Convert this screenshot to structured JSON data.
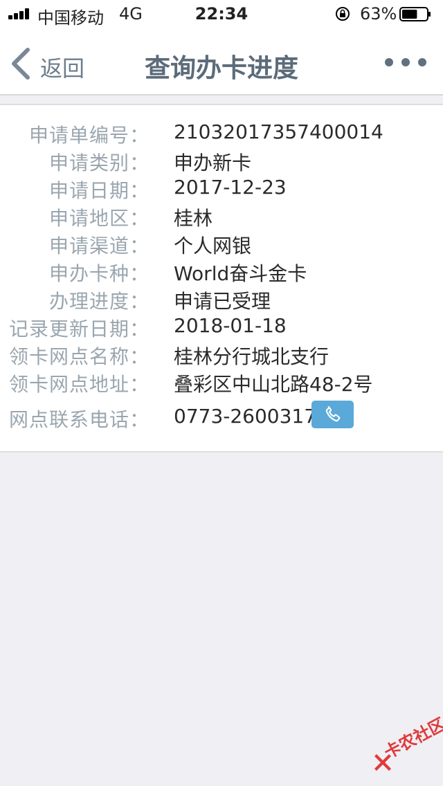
{
  "status_bar": {
    "carrier": "中国移动",
    "network": "4G",
    "time": "22:34",
    "battery_percent": "63%",
    "battery_level": 0.63
  },
  "nav": {
    "back_label": "返回",
    "title": "查询办卡进度"
  },
  "details": [
    {
      "label": "申请单编号：",
      "value": "21032017357400014"
    },
    {
      "label": "申请类别：",
      "value": "申办新卡"
    },
    {
      "label": "申请日期：",
      "value": "2017-12-23"
    },
    {
      "label": "申请地区：",
      "value": "桂林"
    },
    {
      "label": "申请渠道：",
      "value": "个人网银"
    },
    {
      "label": "申办卡种：",
      "value": "World奋斗金卡"
    },
    {
      "label": "办理进度：",
      "value": "申请已受理"
    },
    {
      "label": "记录更新日期：",
      "value": "2018-01-18"
    },
    {
      "label": "领卡网点名称：",
      "value": "桂林分行城北支行"
    },
    {
      "label": "领卡网点地址：",
      "value": "叠彩区中山北路48-2号"
    }
  ],
  "contact": {
    "label": "网点联系电话：",
    "phone": "0773-2600317"
  },
  "watermark": {
    "text": "卡农社区"
  },
  "icons": {
    "back": "chevron-left-icon",
    "more": "more-dots-icon",
    "phone": "phone-icon",
    "lock": "rotation-lock-icon"
  },
  "colors": {
    "nav_title": "#5c6b79",
    "label": "#9aa6af",
    "value": "#2a2a2a",
    "phone_button": "#5aa9d8",
    "background": "#efeff4",
    "watermark": "#e03a3a"
  }
}
